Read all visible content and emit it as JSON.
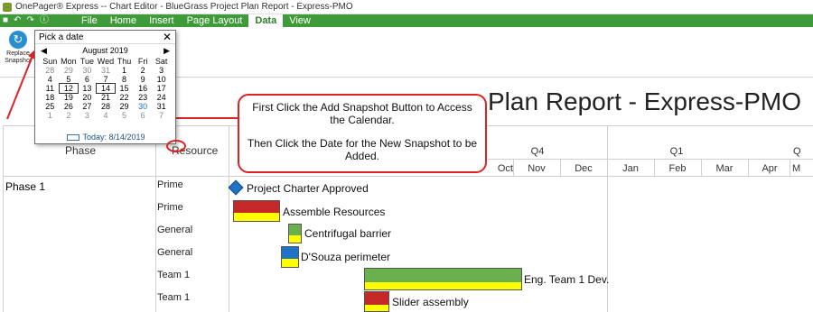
{
  "window": {
    "title": "OnePager® Express -- Chart Editor - BlueGrass Project Plan Report - Express-PMO"
  },
  "menu": {
    "quick_access": [
      "save-icon",
      "undo-icon",
      "redo-icon",
      "help-icon"
    ],
    "items": [
      "File",
      "Home",
      "Insert",
      "Page Layout",
      "Data",
      "View"
    ],
    "active": "Data"
  },
  "ribbon": {
    "replace_snapshot_label": "Replace Snapshot"
  },
  "chart": {
    "title": "Plan Report - Express-PMO",
    "columns": {
      "phase": "Phase",
      "resource": "Resource"
    },
    "quarters": [
      "Q4",
      "Q1",
      "Q"
    ],
    "months": [
      "Oct",
      "Nov",
      "Dec",
      "Jan",
      "Feb",
      "Mar",
      "Apr",
      "M"
    ],
    "phases": [
      {
        "name": "Phase 1"
      }
    ],
    "tasks": [
      {
        "resource": "Prime",
        "label": "Project Charter Approved",
        "type": "milestone"
      },
      {
        "resource": "Prime",
        "label": "Assemble Resources",
        "color": "#c62828"
      },
      {
        "resource": "General",
        "label": "Centrifugal barrier",
        "color": "#6ab04c"
      },
      {
        "resource": "General",
        "label": "D'Souza perimeter",
        "color": "#1f73c4"
      },
      {
        "resource": "Team 1",
        "label": "Eng. Team 1 Dev.",
        "color": "#6ab04c"
      },
      {
        "resource": "Team 1",
        "label": "Slider assembly",
        "color": "#c62828"
      }
    ]
  },
  "date_picker": {
    "title": "Pick a date",
    "month_label": "August 2019",
    "prev_icon": "chevron-left-icon",
    "next_icon": "chevron-right-icon",
    "weekdays": [
      "Sun",
      "Mon",
      "Tue",
      "Wed",
      "Thu",
      "Fri",
      "Sat"
    ],
    "weeks": [
      [
        "28",
        "29",
        "30",
        "31",
        "1",
        "2",
        "3"
      ],
      [
        "4",
        "5",
        "6",
        "7",
        "8",
        "9",
        "10"
      ],
      [
        "11",
        "12",
        "13",
        "14",
        "15",
        "16",
        "17"
      ],
      [
        "18",
        "19",
        "20",
        "21",
        "22",
        "23",
        "24"
      ],
      [
        "25",
        "26",
        "27",
        "28",
        "29",
        "30",
        "31"
      ],
      [
        "1",
        "2",
        "3",
        "4",
        "5",
        "6",
        "7"
      ]
    ],
    "selected": "30",
    "today_label": "Today: 8/14/2019"
  },
  "callout": {
    "line1": "First Click the Add Snapshot Button to Access the Calendar.",
    "line2": "Then Click the Date for the New Snapshot to be Added.",
    "border_color": "#dd2222"
  }
}
